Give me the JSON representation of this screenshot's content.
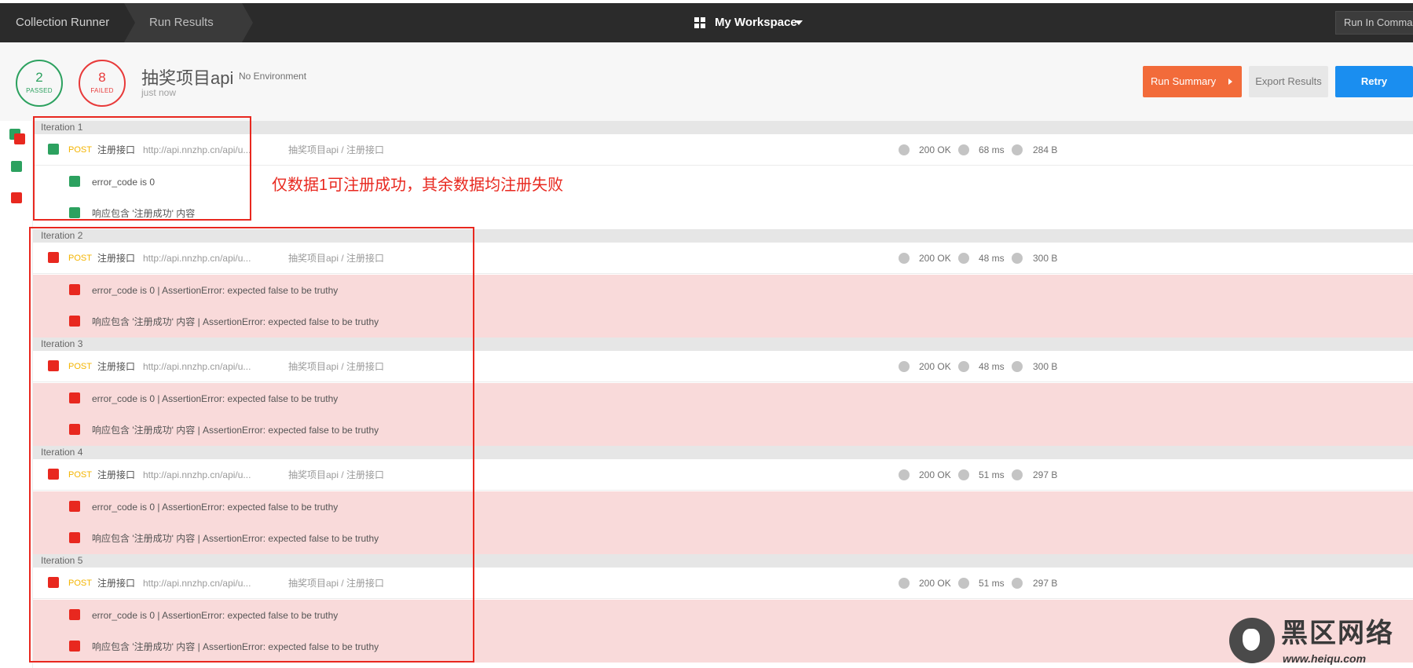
{
  "header": {
    "breadcrumb": [
      "Collection Runner",
      "Run Results"
    ],
    "workspace_label": "My Workspace",
    "run_in_command_label": "Run In Comman"
  },
  "summary": {
    "passed_count": "2",
    "passed_label": "PASSED",
    "failed_count": "8",
    "failed_label": "FAILED",
    "collection_name": "抽奖项目api",
    "environment": "No Environment",
    "time": "just now",
    "run_summary_label": "Run Summary",
    "export_label": "Export Results",
    "retry_label": "Retry"
  },
  "colors": {
    "pass": "#2ca15f",
    "fail": "#e8281f",
    "method_post": "#f4b400",
    "run_summary": "#f26b3a",
    "retry": "#1a8ef0",
    "failed_row_bg": "#f9dada"
  },
  "rail": [
    "mixed",
    "pass",
    "fail"
  ],
  "iterations": [
    {
      "label": "Iteration 1",
      "status": "pass",
      "request": {
        "method": "POST",
        "name": "注册接口",
        "url": "http://api.nnzhp.cn/api/u...",
        "path": "抽奖项目api / 注册接口",
        "status": "200 OK",
        "time": "68 ms",
        "size": "284 B"
      },
      "tests": [
        {
          "status": "pass",
          "text": "error_code is 0"
        },
        {
          "status": "pass",
          "text": "响应包含 '注册成功' 内容"
        }
      ]
    },
    {
      "label": "Iteration 2",
      "status": "fail",
      "request": {
        "method": "POST",
        "name": "注册接口",
        "url": "http://api.nnzhp.cn/api/u...",
        "path": "抽奖项目api / 注册接口",
        "status": "200 OK",
        "time": "48 ms",
        "size": "300 B"
      },
      "tests": [
        {
          "status": "fail",
          "text": "error_code is 0 | AssertionError: expected false to be truthy"
        },
        {
          "status": "fail",
          "text": "响应包含 '注册成功' 内容 | AssertionError: expected false to be truthy"
        }
      ]
    },
    {
      "label": "Iteration 3",
      "status": "fail",
      "request": {
        "method": "POST",
        "name": "注册接口",
        "url": "http://api.nnzhp.cn/api/u...",
        "path": "抽奖项目api / 注册接口",
        "status": "200 OK",
        "time": "48 ms",
        "size": "300 B"
      },
      "tests": [
        {
          "status": "fail",
          "text": "error_code is 0 | AssertionError: expected false to be truthy"
        },
        {
          "status": "fail",
          "text": "响应包含 '注册成功' 内容 | AssertionError: expected false to be truthy"
        }
      ]
    },
    {
      "label": "Iteration 4",
      "status": "fail",
      "request": {
        "method": "POST",
        "name": "注册接口",
        "url": "http://api.nnzhp.cn/api/u...",
        "path": "抽奖项目api / 注册接口",
        "status": "200 OK",
        "time": "51 ms",
        "size": "297 B"
      },
      "tests": [
        {
          "status": "fail",
          "text": "error_code is 0 | AssertionError: expected false to be truthy"
        },
        {
          "status": "fail",
          "text": "响应包含 '注册成功' 内容 | AssertionError: expected false to be truthy"
        }
      ]
    },
    {
      "label": "Iteration 5",
      "status": "fail",
      "request": {
        "method": "POST",
        "name": "注册接口",
        "url": "http://api.nnzhp.cn/api/u...",
        "path": "抽奖项目api / 注册接口",
        "status": "200 OK",
        "time": "51 ms",
        "size": "297 B"
      },
      "tests": [
        {
          "status": "fail",
          "text": "error_code is 0 | AssertionError: expected false to be truthy"
        },
        {
          "status": "fail",
          "text": "响应包含 '注册成功' 内容 | AssertionError: expected false to be truthy"
        }
      ]
    }
  ],
  "annotation": {
    "text": "仅数据1可注册成功，其余数据均注册失败"
  },
  "watermark": {
    "title": "黑区网络",
    "url": "www.heiqu.com"
  }
}
